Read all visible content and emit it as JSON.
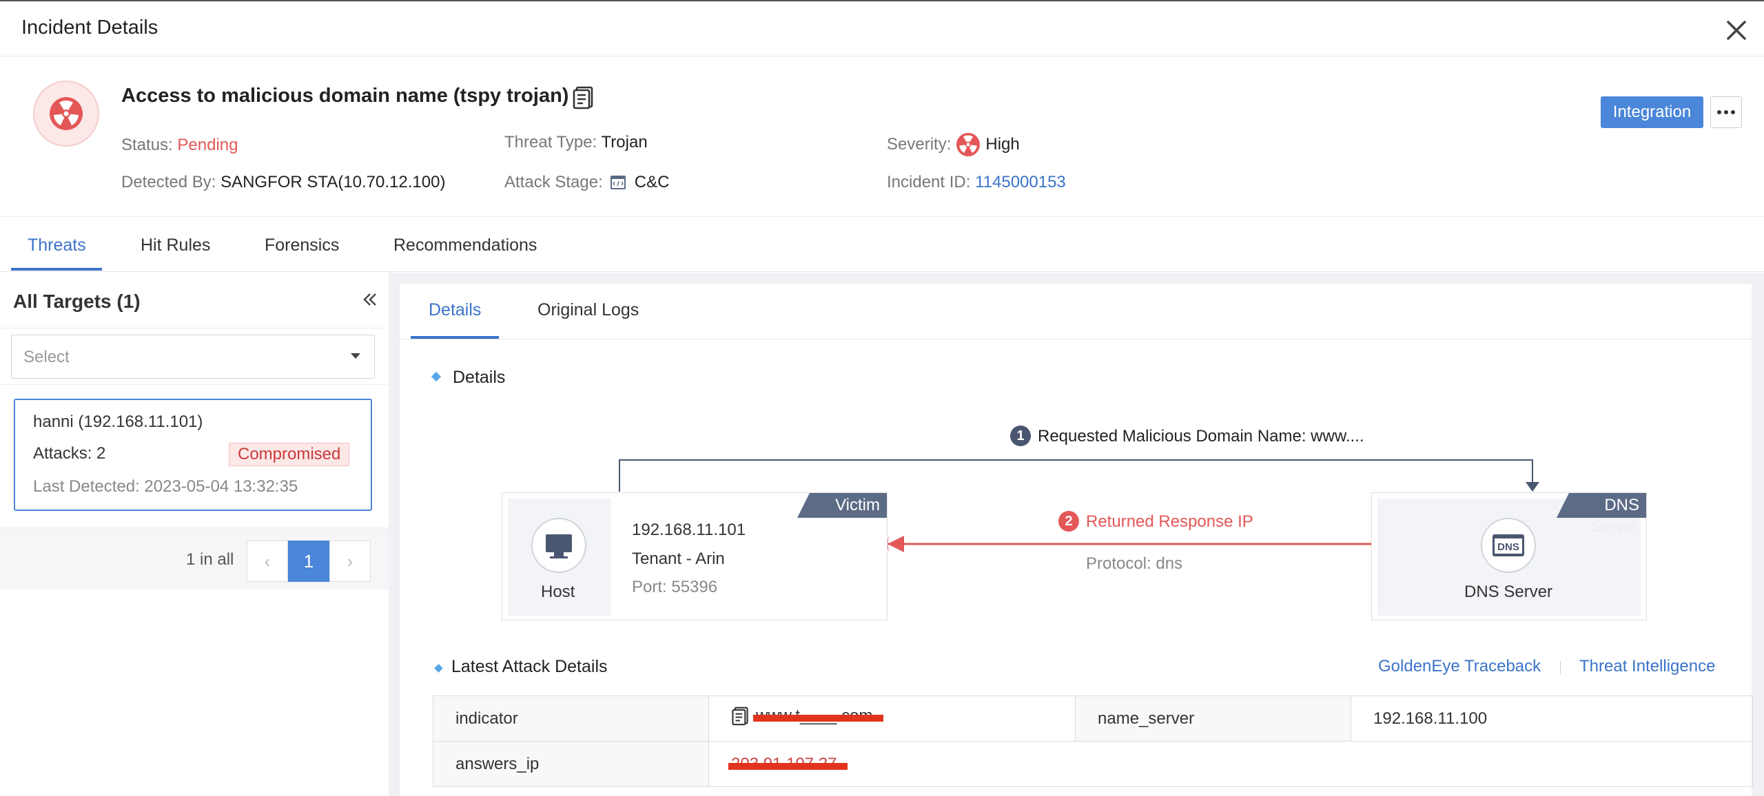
{
  "header": {
    "title": "Incident Details"
  },
  "incident": {
    "title": "Access to malicious domain name (tspy trojan)",
    "fields": {
      "status_label": "Status:",
      "status_value": "Pending",
      "threat_type_label": "Threat Type:",
      "threat_type_value": "Trojan",
      "severity_label": "Severity:",
      "severity_value": "High",
      "detected_by_label": "Detected By:",
      "detected_by_value": "SANGFOR STA(10.70.12.100)",
      "attack_stage_label": "Attack Stage:",
      "attack_stage_value": "C&C",
      "incident_id_label": "Incident ID:",
      "incident_id_value": "1145000153"
    },
    "integration_label": "Integration",
    "more_label": "···"
  },
  "tabs": [
    "Threats",
    "Hit Rules",
    "Forensics",
    "Recommendations"
  ],
  "left_panel": {
    "title": "All Targets (1)",
    "select_placeholder": "Select",
    "target": {
      "name": "hanni (192.168.11.101)",
      "attacks": "Attacks: 2",
      "status": "Compromised",
      "last_detected": "Last Detected: 2023-05-04 13:32:35"
    },
    "pagination": {
      "total": "1 in all",
      "current": "1",
      "prev": "‹",
      "next": "›"
    }
  },
  "right_panel": {
    "subtabs": [
      "Details",
      "Original Logs"
    ],
    "details_heading": "Details",
    "diagram": {
      "step1_num": "1",
      "step1_text": "Requested Malicious Domain Name: www....",
      "step2_num": "2",
      "step2_text": "Returned Response IP",
      "protocol": "Protocol: dns",
      "victim": {
        "tag": "Victim",
        "label": "Host",
        "ip": "192.168.11.101",
        "tenant": "Tenant - Arin",
        "port": "Port: 55396"
      },
      "server": {
        "tag": "DNS",
        "tag_sub": "Server",
        "label": "DNS Server",
        "icon_text": "DNS"
      }
    },
    "latest_heading": "Latest Attack Details",
    "links": {
      "traceback": "GoldenEye Traceback",
      "intel": "Threat Intelligence"
    },
    "table": {
      "indicator_key": "indicator",
      "indicator_value": "www.t____.com",
      "name_server_key": "name_server",
      "name_server_value": "192.168.11.100",
      "answers_ip_key": "answers_ip",
      "answers_ip_value": "203.91.107.27"
    }
  },
  "colors": {
    "accent": "#4a86d9",
    "danger": "#e45757",
    "navy": "#4a5670"
  }
}
